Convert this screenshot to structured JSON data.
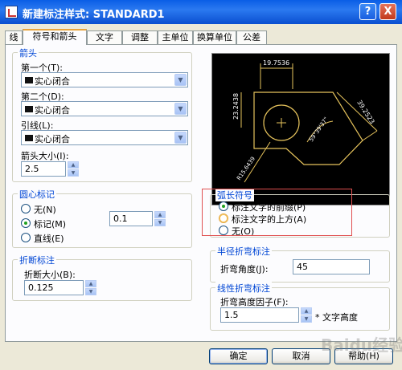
{
  "title": "新建标注样式: STANDARD1",
  "title_buttons": {
    "help": "?",
    "close": "X"
  },
  "tabs": [
    "线",
    "符号和箭头",
    "文字",
    "调整",
    "主单位",
    "换算单位",
    "公差"
  ],
  "active_tab": "符号和箭头",
  "arrowheads": {
    "title": "箭头",
    "first_label": "第一个(T):",
    "first_value": "实心闭合",
    "second_label": "第二个(D):",
    "second_value": "实心闭合",
    "leader_label": "引线(L):",
    "leader_value": "实心闭合",
    "size_label": "箭头大小(I):",
    "size_value": "2.5"
  },
  "center_marks": {
    "title": "圆心标记",
    "options": [
      "无(N)",
      "标记(M)",
      "直线(E)"
    ],
    "selected": "标记(M)",
    "size_value": "0.1"
  },
  "break": {
    "title": "折断标注",
    "size_label": "折断大小(B):",
    "size_value": "0.125"
  },
  "arc_length": {
    "title": "弧长符号",
    "options": [
      "标注文字的前缀(P)",
      "标注文字的上方(A)",
      "无(O)"
    ],
    "selected": "标注文字的前缀(P)"
  },
  "radius_jog": {
    "title": "半径折弯标注",
    "angle_label": "折弯角度(J):",
    "angle_value": "45"
  },
  "linear_jog": {
    "title": "线性折弯标注",
    "height_label": "折弯高度因子(F):",
    "height_value": "1.5",
    "suffix": "* 文字高度"
  },
  "preview": {
    "dim_top": "19.7536",
    "dim_left": "23.2438",
    "dim_right": "39.2523",
    "dim_angle": "59°39'37\"",
    "dim_radius": "R15.6439"
  },
  "buttons": {
    "ok": "确定",
    "cancel": "取消",
    "help": "帮助(H)"
  },
  "watermark": "Baidu经验",
  "colors": {
    "title_bar": "#0a5ee6",
    "group_title": "#0046d5",
    "highlight": "#e05050",
    "preview_bg": "#000000",
    "dim_lines": "#e6c35c"
  }
}
